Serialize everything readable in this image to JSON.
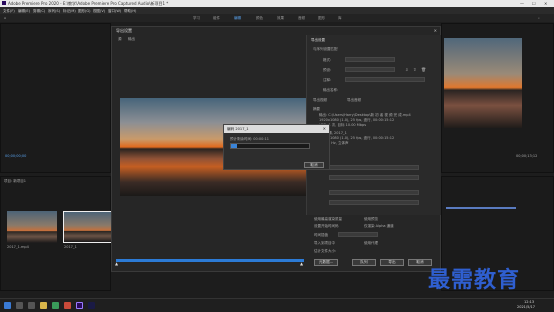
{
  "window": {
    "title": "Adobe Premiere Pro 2020 - E:\\教学\\Adobe Premiere Pro Captured Audio\\新项目1 *"
  },
  "menu": [
    "文件(F)",
    "编辑(E)",
    "剪辑(C)",
    "序列(S)",
    "标记(M)",
    "图形(G)",
    "视图(V)",
    "窗口(W)",
    "帮助(H)"
  ],
  "workspaces": [
    "学习",
    "组件",
    "编辑",
    "颜色",
    "效果",
    "音频",
    "图形",
    "库"
  ],
  "active_workspace": "编辑",
  "dialog": {
    "title": "导出设置",
    "tabs": [
      "源",
      "输出"
    ],
    "settings_title": "导出设置",
    "labels": [
      "与序列设置匹配",
      "格式:",
      "预设:",
      "注释:",
      "输出名称:",
      "导出视频",
      "导出音频",
      "摘要"
    ],
    "summary": [
      "输出: C:\\Users\\Harry\\Desktop\\新 初 者 视 频 完 成.mp4",
      "1920x1080 (1.0), 25 fps, 逐行, 00:00:15:12",
      "VBR, 1 次, 目标 10.00 Mbps",
      "源: 剪辑, 2017_1",
      "1920x1080 (1.0), 25 fps, 逐行, 00:00:15:12",
      "48000 Hz, 立体声"
    ],
    "bottom_labels": [
      "使用最高渲染质量",
      "使用预览",
      "设置开始时间码",
      "仅渲染 Alpha 通道",
      "时间插值",
      "帧采样",
      "导入到项目中",
      "使用代理",
      "估计文件大小:"
    ],
    "buttons": [
      "元数据...",
      "队列",
      "导出",
      "取消"
    ]
  },
  "progress_dialog": {
    "title": "编码 2017_1",
    "close": "✕",
    "label": "预计剩余时间: 00:00:11",
    "progress": 0.08,
    "cancel": "取消"
  },
  "left_timecode": "00;00;00;00",
  "right_timecode": "00;00;13;12",
  "project": {
    "label": "项目: 新项目1",
    "items": [
      "2017_1.mp4",
      "2017_1"
    ]
  },
  "taskbar": {
    "time": "12:13",
    "date": "2021/5/17"
  },
  "watermark": "最需教育",
  "colors": {
    "accent": "#3a84d8",
    "watermark": "#2f5fd0"
  }
}
